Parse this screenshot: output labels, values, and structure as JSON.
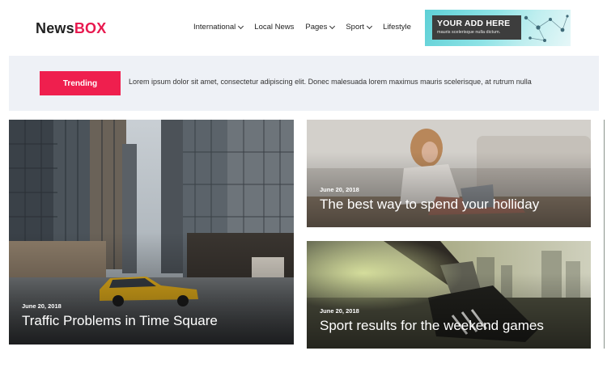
{
  "header": {
    "logo_part1": "News",
    "logo_part2": "BOX",
    "nav": [
      {
        "label": "International",
        "dropdown": true
      },
      {
        "label": "Local News",
        "dropdown": false
      },
      {
        "label": "Pages",
        "dropdown": true
      },
      {
        "label": "Sport",
        "dropdown": true
      },
      {
        "label": "Lifestyle",
        "dropdown": false
      }
    ],
    "ad": {
      "title": "YOUR ADD HERE",
      "subtitle": "mauris scelerisque nulla dictum."
    }
  },
  "trending": {
    "label": "Trending",
    "text": "Lorem ipsum dolor sit amet, consectetur adipiscing elit. Donec malesuada lorem maximus mauris scelerisque, at rutrum nulla"
  },
  "articles": [
    {
      "date": "June 20, 2018",
      "title": "Traffic Problems in Time Square"
    },
    {
      "date": "June 20, 2018",
      "title": "The best way to spend your holliday"
    },
    {
      "date": "June 20, 2018",
      "title": "Sport results for the weekend games"
    }
  ],
  "colors": {
    "accent": "#e8194f",
    "trending_button": "#ef1f4e",
    "trending_bg": "#eef1f6"
  }
}
